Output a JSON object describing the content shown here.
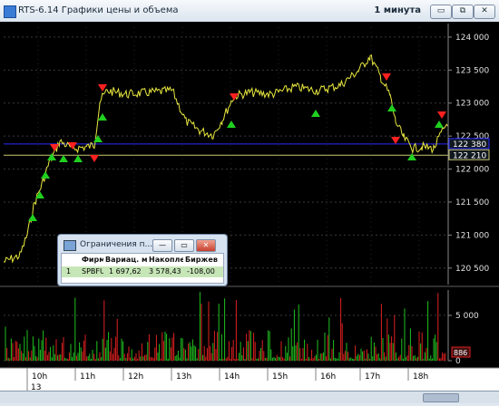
{
  "window": {
    "title": "RTS-6.14 Графики цены и объема",
    "interval": "1 минута",
    "buttons": {
      "minimize": "▭",
      "restore": "⧉",
      "close": "✕"
    }
  },
  "price_axis": {
    "ticks": [
      "124 000",
      "123 500",
      "123 000",
      "122 500",
      "122 000",
      "121 500",
      "121 000",
      "120 500"
    ],
    "tick_values": [
      124000,
      123500,
      123000,
      122500,
      122000,
      121500,
      121000,
      120500
    ],
    "markers": [
      {
        "label": "122 380",
        "value": 122380,
        "line_color": "#2a2aff"
      },
      {
        "label": "122 210",
        "value": 122210,
        "line_color": "#c8c870"
      }
    ]
  },
  "volume_axis": {
    "ticks": [
      "5 000",
      "0"
    ],
    "tick_values": [
      5000,
      0
    ],
    "last_label": "886"
  },
  "time_axis": {
    "labels": [
      "10h",
      "11h",
      "12h",
      "13h",
      "14h",
      "15h",
      "16h",
      "17h",
      "18h"
    ],
    "date_label": "13"
  },
  "colors": {
    "price_line": "#e8e840",
    "up_arrow": "#20d020",
    "down_arrow": "#ff2020",
    "vol_up": "#20c020",
    "vol_down": "#e02020",
    "background": "#000000",
    "grid": "#3a3a3a"
  },
  "mini_window": {
    "title": "Ограничения п...",
    "buttons": {
      "minimize": "—",
      "restore": "▭",
      "close": "✕"
    },
    "columns": [
      "Фирм",
      "Вариац. м",
      "Накопле",
      "Биржев"
    ],
    "rows": [
      {
        "index": "1",
        "cells": [
          "SPBFU",
          "1 697,62",
          "3 578,43",
          "-108,00"
        ]
      }
    ]
  }
}
